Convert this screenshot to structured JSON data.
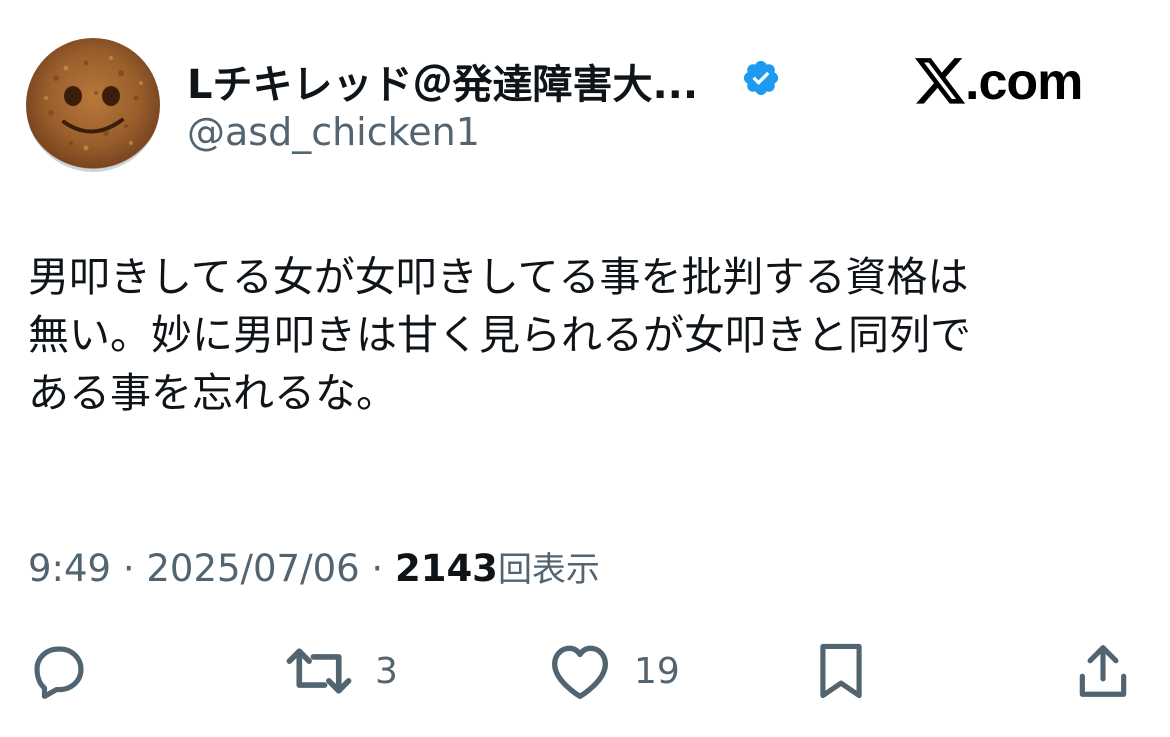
{
  "tweet": {
    "display_name": "Lチキレッド＠発達障害大...",
    "handle": "@asd_chicken1",
    "source_logo": ".com",
    "body_lines": [
      "男叩きしてる女が女叩きしてる事を批判する資格は",
      "無い。妙に男叩きは甘く見られるが女叩きと同列で",
      "ある事を忘れるな。"
    ],
    "time": "9:49",
    "separator": " · ",
    "date": "2025/07/06",
    "views_count": "2143",
    "views_label": "回表示"
  },
  "actions": {
    "reply": {
      "icon": "reply-icon",
      "count": ""
    },
    "retweet": {
      "icon": "retweet-icon",
      "count": "3"
    },
    "like": {
      "icon": "heart-icon",
      "count": "19"
    },
    "bookmark": {
      "icon": "bookmark-icon",
      "count": ""
    },
    "share": {
      "icon": "share-icon",
      "count": ""
    }
  },
  "colors": {
    "text": "#0f1419",
    "secondary": "#536471",
    "verified": "#1d9bf0"
  }
}
